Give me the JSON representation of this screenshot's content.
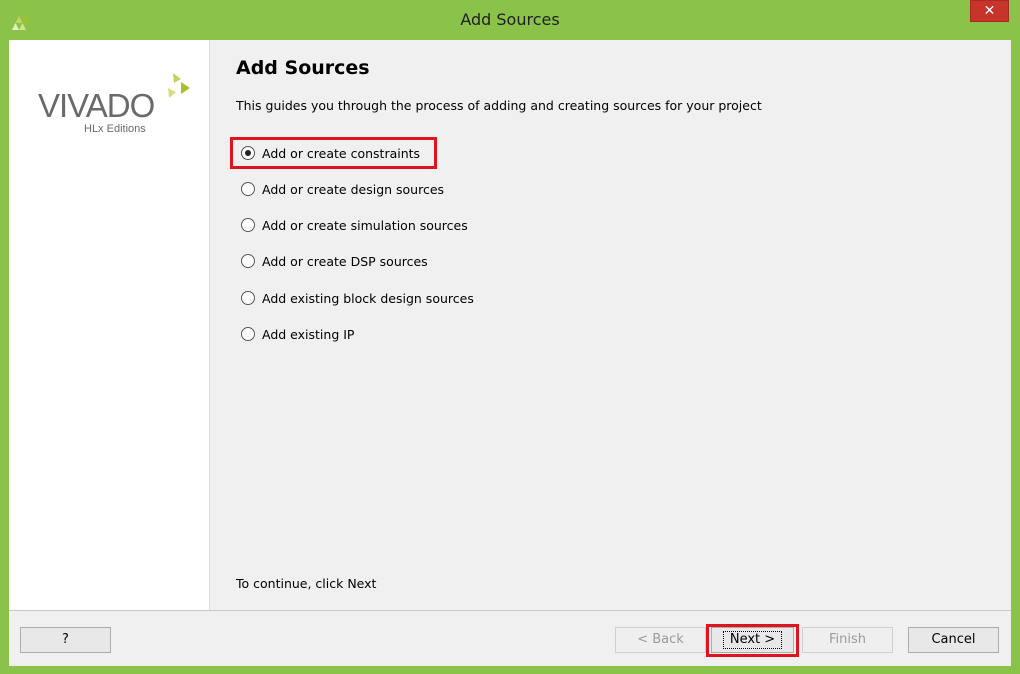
{
  "window": {
    "title": "Add Sources",
    "close_label": "✕"
  },
  "logo": {
    "brand": "VIVADO",
    "edition": "HLx Editions"
  },
  "main": {
    "heading": "Add Sources",
    "description": "This guides you through the process of adding and creating sources for your project",
    "options": [
      {
        "label": "Add or create constraints",
        "selected": true
      },
      {
        "label": "Add or create design sources",
        "selected": false
      },
      {
        "label": "Add or create simulation sources",
        "selected": false
      },
      {
        "label": "Add or create DSP sources",
        "selected": false
      },
      {
        "label": "Add existing block design sources",
        "selected": false
      },
      {
        "label": "Add existing IP",
        "selected": false
      }
    ],
    "continue_text": "To continue, click Next"
  },
  "footer": {
    "help_label": "?",
    "back_label": "< Back",
    "next_label": "Next >",
    "finish_label": "Finish",
    "cancel_label": "Cancel"
  },
  "colors": {
    "frame": "#8bc34a",
    "highlight": "#e0141e",
    "close": "#c7342a"
  }
}
